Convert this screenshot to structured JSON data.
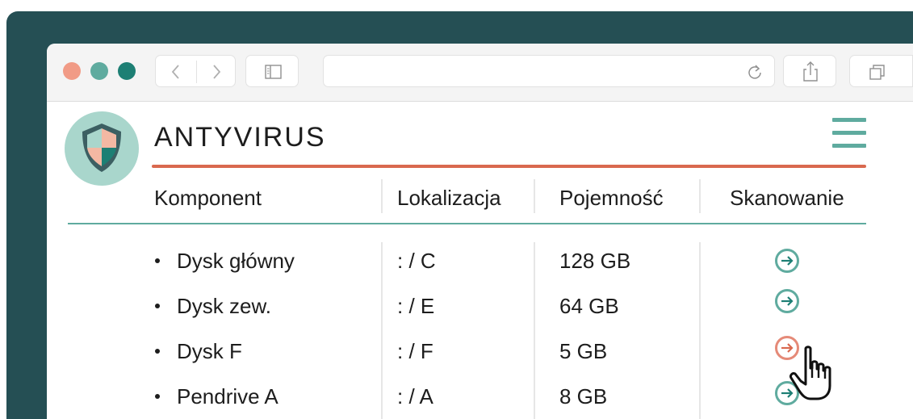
{
  "app": {
    "title": "ANTYVIRUS"
  },
  "table": {
    "headers": [
      "Komponent",
      "Lokalizacja",
      "Pojemność",
      "Skanowanie"
    ],
    "rows": [
      {
        "component": "Dysk główny",
        "location": ": / C",
        "capacity": "128 GB",
        "state": "default"
      },
      {
        "component": "Dysk zew.",
        "location": ": / E",
        "capacity": "64 GB",
        "state": "default"
      },
      {
        "component": "Dysk F",
        "location": ": / F",
        "capacity": "5 GB",
        "state": "hover"
      },
      {
        "component": "Pendrive A",
        "location": ": / A",
        "capacity": "8 GB",
        "state": "default"
      }
    ]
  },
  "icons": {
    "logo": "shield-icon",
    "menu": "hamburger-menu-icon",
    "scan": "arrow-right-circle-icon",
    "cursor": "hand-pointer-icon"
  },
  "colors": {
    "frame": "#254f54",
    "accent_teal": "#5fab9f",
    "accent_coral": "#d9694f",
    "hover_scan": "#e58a78",
    "logo_bg": "#a9d6cc",
    "traffic_red": "#f19b86",
    "traffic_teal": "#5fab9f",
    "traffic_dark": "#1d7f74"
  }
}
